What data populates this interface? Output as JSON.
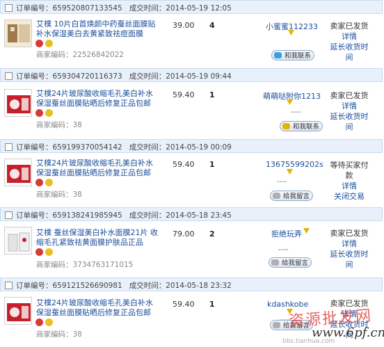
{
  "labels": {
    "order_no": "订单编号：",
    "deal_time": "成交时间：",
    "merchant_code": "商家编码："
  },
  "orders": [
    {
      "order_no": "659520807133545",
      "time": "2014-05-19 12:05",
      "title": "艾樸 10片白首焕颜中药蚕丝面膜贴 补水保湿美白去黄紧致祛痘面膜",
      "merchant_code": "22526842022",
      "price": "39.00",
      "qty": "4",
      "buyer": "小蜜蜜112233",
      "dash": "",
      "contact": "和我联系",
      "status": "卖家已发货",
      "link1": "详情",
      "link2": "延长收货时间"
    },
    {
      "order_no": "659304720116373",
      "time": "2014-05-19 09:44",
      "title": "艾樸24片玻尿酸收缩毛孔美白补水保湿蚕丝面膜贴晒后修复正品包邮",
      "merchant_code": "38",
      "price": "59.40",
      "qty": "1",
      "buyer": "萌萌哒附你1213",
      "dash": "----",
      "contact": "和我联系",
      "status": "卖家已发货",
      "link1": "详情",
      "link2": "延长收货时间"
    },
    {
      "order_no": "659199370054142",
      "time": "2014-05-19 00:09",
      "title": "艾樸24片玻尿酸收缩毛孔美白补水保湿蚕丝面膜贴晒后修复正品包邮",
      "merchant_code": "38",
      "price": "59.40",
      "qty": "1",
      "buyer": "13675599202s",
      "dash": "----",
      "contact": "给我留言",
      "status": "等待买家付款",
      "link1": "详情",
      "link2": "关闭交易"
    },
    {
      "order_no": "659138241985945",
      "time": "2014-05-18 23:45",
      "title": "艾樸 蚕丝保湿美白补水面膜21片 收缩毛孔紧致祛黄面膜护肤品正品",
      "merchant_code": "3734763171015",
      "price": "79.00",
      "qty": "2",
      "buyer": "拒绝玩弄",
      "dash": "----",
      "contact": "给我留言",
      "status": "卖家已发货",
      "link1": "详情",
      "link2": "延长收货时间"
    },
    {
      "order_no": "659121526690981",
      "time": "2014-05-18 23:32",
      "title": "艾樸24片玻尿酸收缩毛孔美白补水保湿蚕丝面膜贴晒后修复正品包邮",
      "merchant_code": "38",
      "price": "59.40",
      "qty": "1",
      "buyer": "kdashkobe",
      "dash": "----",
      "contact": "给我留言",
      "status": "卖家已发货",
      "link1": "详情",
      "link2": "延长收货时间"
    }
  ],
  "watermark": {
    "line1": "资源批发网",
    "line2": "www.6pf.cn",
    "line3": "bbs.tianhua.com"
  },
  "colors": {
    "header_bg": "#e8f1fb",
    "link": "#1a4c9c",
    "watermark_red": "#e03030"
  }
}
